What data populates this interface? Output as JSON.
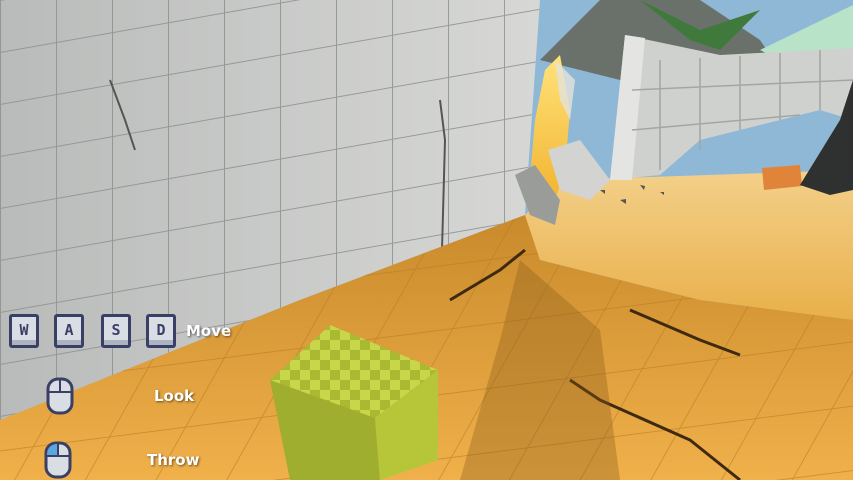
{
  "hud": {
    "controls": [
      {
        "keys": [
          "W",
          "A",
          "S",
          "D"
        ],
        "label": "Move"
      },
      {
        "icon": "mouse-icon",
        "label": "Look"
      },
      {
        "icon": "mouse-left-click-icon",
        "label": "Throw"
      }
    ]
  },
  "colors": {
    "wall": "#c9cbc9",
    "grid_line": "#8e908f",
    "floor": "#e8a93f",
    "sand": "#f0c873",
    "sky": "#8fb8d6",
    "cube": "#b9c83a",
    "fire": "#f7d84a",
    "key_border": "#3a3f66",
    "mouse_highlight": "#5aa7e0"
  }
}
